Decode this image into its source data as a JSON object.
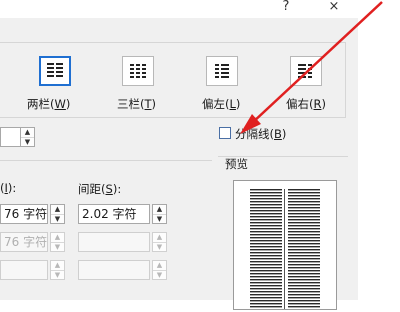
{
  "titlebar": {
    "help_glyph": "?",
    "close_glyph": "×"
  },
  "presets": [
    {
      "label": "两栏",
      "key": "W",
      "selected": true
    },
    {
      "label": "三栏",
      "key": "T",
      "selected": false
    },
    {
      "label": "偏左",
      "key": "L",
      "selected": false
    },
    {
      "label": "偏右",
      "key": "R",
      "selected": false
    }
  ],
  "separator": {
    "label": "分隔线",
    "key": "B",
    "checked": false
  },
  "preview": {
    "title": "预览"
  },
  "width_spacing": {
    "width_label_fragment": "I",
    "width_label_suffix": "):",
    "spacing_label": "间距",
    "spacing_key": "S",
    "spacing_label_suffix": ":",
    "rows": [
      {
        "width": "76 字符",
        "spacing": "2.02 字符",
        "enabled": true
      },
      {
        "width": "76 字符",
        "spacing": "",
        "enabled": false
      },
      {
        "width": "",
        "spacing": "",
        "enabled": false
      }
    ]
  },
  "colors": {
    "accent": "#1f6fd1",
    "arrow": "#e02020"
  }
}
